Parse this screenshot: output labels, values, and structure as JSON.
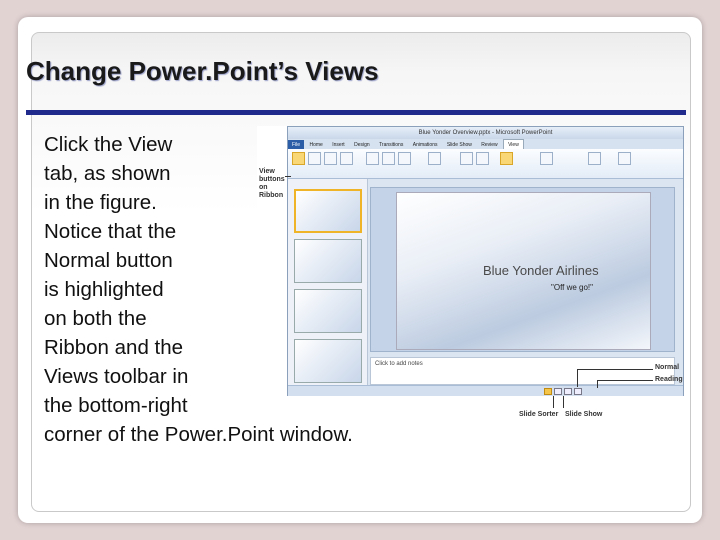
{
  "slide": {
    "title": "Change Power.Point’s Views",
    "body_lines": [
      "Click the View",
      "tab, as shown",
      "in the figure.",
      "Notice that the",
      "Normal button",
      "is highlighted",
      "on both the",
      "Ribbon and the",
      "Views toolbar in",
      "the bottom-right",
      "corner of the Power.Point window."
    ]
  },
  "figure": {
    "window_title": "Blue Yonder Overview.pptx - Microsoft PowerPoint",
    "tabs": [
      "File",
      "Home",
      "Insert",
      "Design",
      "Transitions",
      "Animations",
      "Slide Show",
      "Review",
      "View"
    ],
    "slide_title": "Blue Yonder Airlines",
    "slide_subtitle": "\"Off we go!\"",
    "notes_placeholder": "Click to add notes",
    "callouts": {
      "view_buttons": "View buttons on Ribbon",
      "normal": "Normal",
      "reading": "Reading",
      "slide_sorter": "Slide Sorter",
      "slide_show": "Slide Show"
    },
    "colors": {
      "title_rule": "#1f2a8c",
      "highlight": "#f5c54a",
      "file_tab": "#2c5ea8"
    }
  }
}
